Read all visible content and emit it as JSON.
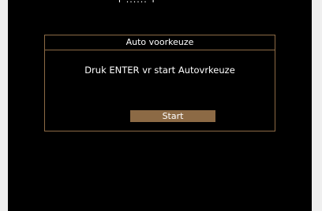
{
  "top_text": "[ ...... ]",
  "dialog": {
    "title": "Auto voorkeuze",
    "message": "Druk ENTER vr start Autovrkeuze",
    "start_label": "Start"
  },
  "colors": {
    "screen_background": "#000000",
    "frame_accent": "#8c6a45",
    "text": "#ffffff",
    "page_background": "#efefef"
  }
}
